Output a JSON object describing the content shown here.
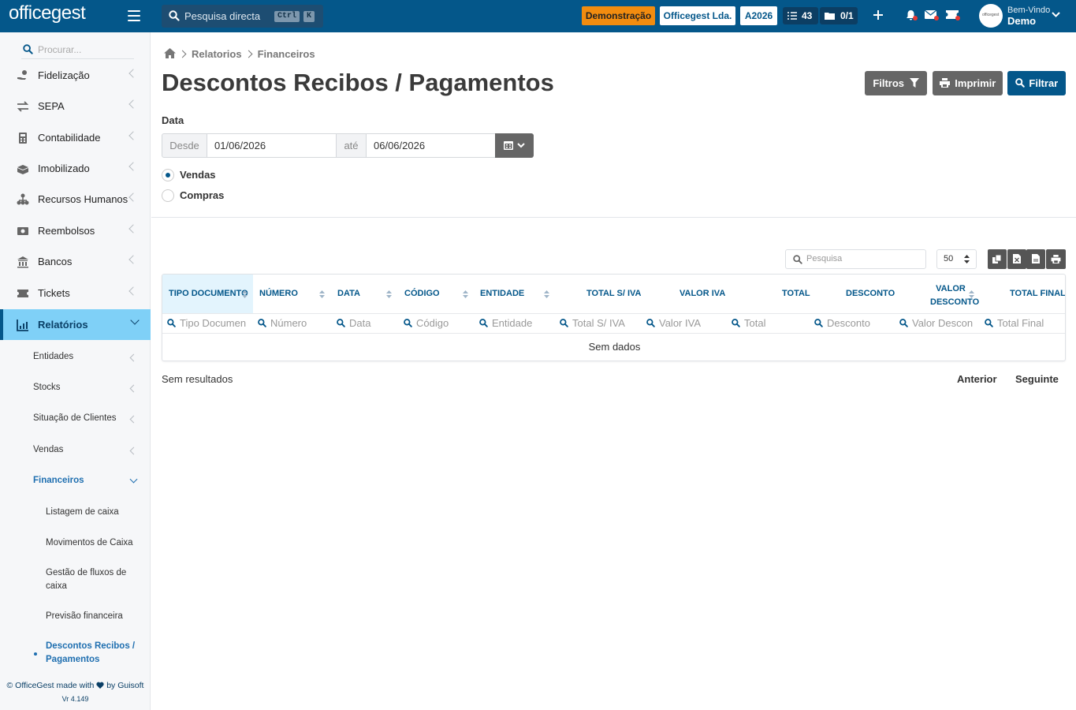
{
  "topbar": {
    "logo": "officegest",
    "search_label": "Pesquisa directa",
    "kbd_ctrl": "Ctrl",
    "kbd_k": "K",
    "badge_demo": "Demonstração",
    "badge_company": "Officegest Lda.",
    "badge_year": "A2026",
    "tasks_count": "43",
    "folders_count": "0/1",
    "welcome": "Bem-Vindo",
    "user_name": "Demo",
    "avatar_text": "officegest",
    "colors": {
      "bar": "#04578a",
      "demo_badge": "#f28c0f",
      "notify_dot": "#e53935"
    }
  },
  "sidebar": {
    "search_placeholder": "Procurar...",
    "menu": [
      {
        "label": "Fidelização",
        "icon": "hand-coin-icon"
      },
      {
        "label": "SEPA",
        "icon": "arrows-exchange-icon"
      },
      {
        "label": "Contabilidade",
        "icon": "calculator-icon"
      },
      {
        "label": "Imobilizado",
        "icon": "boxes-icon"
      },
      {
        "label": "Recursos Humanos",
        "icon": "org-chart-icon"
      },
      {
        "label": "Reembolsos",
        "icon": "money-bill-icon"
      },
      {
        "label": "Bancos",
        "icon": "bank-icon"
      },
      {
        "label": "Tickets",
        "icon": "ticket-icon"
      },
      {
        "label": "Relatórios",
        "icon": "chart-icon"
      }
    ],
    "submenu": [
      {
        "label": "Entidades"
      },
      {
        "label": "Stocks"
      },
      {
        "label": "Situação de Clientes"
      },
      {
        "label": "Vendas"
      },
      {
        "label": "Financeiros"
      }
    ],
    "subsubmenu": [
      {
        "label": "Listagem de caixa"
      },
      {
        "label": "Movimentos de Caixa"
      },
      {
        "label": "Gestão de fluxos de caixa"
      },
      {
        "label": "Previsão financeira"
      },
      {
        "label": "Descontos Recibos / Pagamentos"
      }
    ],
    "footer_prefix": "© OfficeGest made with",
    "footer_suffix": "by Guisoft",
    "version": "Vr 4.149"
  },
  "page": {
    "breadcrumb": [
      "Relatorios",
      "Financeiros"
    ],
    "title": "Descontos Recibos / Pagamentos",
    "btn_filters": "Filtros",
    "btn_print": "Imprimir",
    "btn_filter": "Filtrar",
    "date_label": "Data",
    "from_addon": "Desde",
    "from_value": "01/06/2026",
    "to_addon": "até",
    "to_value": "06/06/2026",
    "radio_sales": "Vendas",
    "radio_purchases": "Compras",
    "radio_selected": "Vendas"
  },
  "table": {
    "search_placeholder": "Pesquisa",
    "page_size": "50",
    "columns": [
      {
        "label": "TIPO DOCUMENTO",
        "filter": "Tipo Documen"
      },
      {
        "label": "NÚMERO",
        "filter": "Número"
      },
      {
        "label": "DATA",
        "filter": "Data"
      },
      {
        "label": "CÓDIGO",
        "filter": "Código"
      },
      {
        "label": "ENTIDADE",
        "filter": "Entidade"
      },
      {
        "label": "TOTAL S/ IVA",
        "filter": "Total S/ IVA"
      },
      {
        "label": "VALOR IVA",
        "filter": "Valor IVA"
      },
      {
        "label": "TOTAL",
        "filter": "Total"
      },
      {
        "label": "DESCONTO",
        "filter": "Desconto"
      },
      {
        "label": "VALOR DESCONTO",
        "filter": "Valor Descon"
      },
      {
        "label": "TOTAL FINAL",
        "filter": "Total Final"
      }
    ],
    "no_data": "Sem dados",
    "no_results": "Sem resultados",
    "prev": "Anterior",
    "next": "Seguinte"
  }
}
